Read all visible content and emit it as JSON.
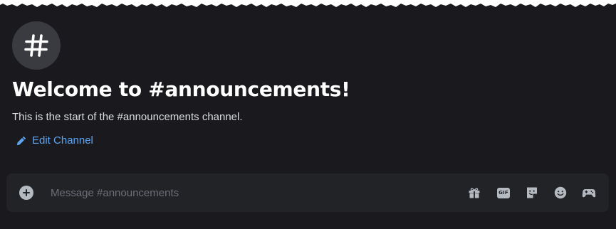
{
  "channel": {
    "icon": "hashtag-icon",
    "welcome_title": "Welcome to #announcements!",
    "welcome_subtitle": "This is the start of the #announcements channel.",
    "edit_label": "Edit Channel",
    "edit_icon": "pencil-icon"
  },
  "composer": {
    "placeholder": "Message #announcements",
    "value": "",
    "attach_icon": "plus-circle-icon",
    "tools": [
      {
        "name": "gift-icon"
      },
      {
        "name": "gif-icon",
        "label": "GIF"
      },
      {
        "name": "sticker-icon"
      },
      {
        "name": "emoji-icon"
      },
      {
        "name": "apps-icon"
      }
    ]
  },
  "colors": {
    "background": "#1a1a1e",
    "composer_background": "#222327",
    "link": "#5ea4f0",
    "icon": "#b5bac1",
    "channel_icon_bg": "#3a3b40"
  }
}
